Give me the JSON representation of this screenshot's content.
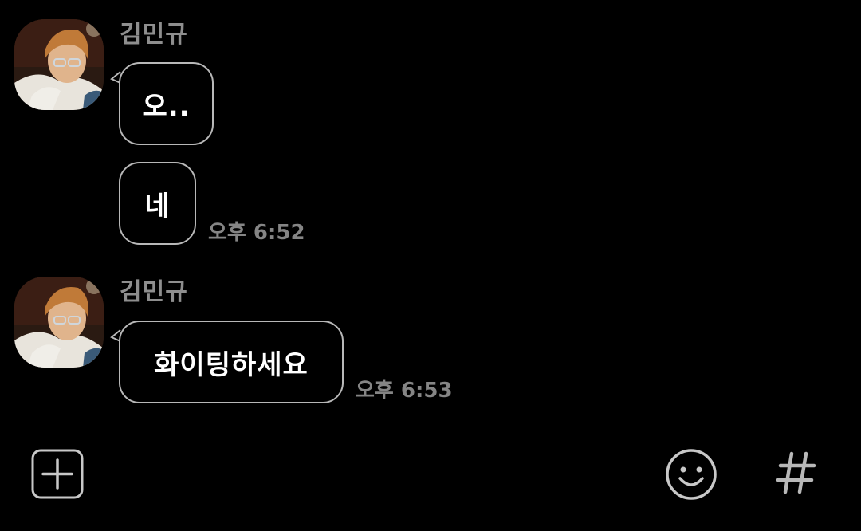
{
  "messages": [
    {
      "sender": "김민규",
      "text": "오..",
      "time": ""
    },
    {
      "sender": "",
      "text": "네",
      "time": "오후 6:52"
    },
    {
      "sender": "김민규",
      "text": "화이팅하세요",
      "time": "오후 6:53"
    }
  ],
  "composer": {
    "left_icon": "plus-icon",
    "right_icons": [
      "emoji-icon",
      "hashtag-icon"
    ]
  },
  "colors": {
    "background": "#000000",
    "bubble_border": "#b8b8b8",
    "bubble_text": "#ffffff",
    "meta_text": "#858585",
    "icon": "#c8c8c8"
  }
}
